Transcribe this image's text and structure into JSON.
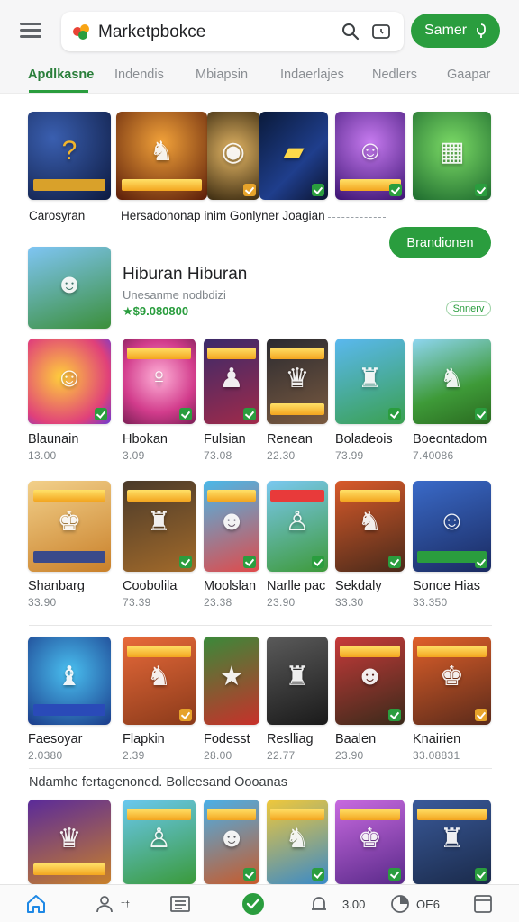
{
  "header": {
    "title": "Marketpbokce",
    "search_icon": "search-icon",
    "wallet_icon": "wallet-icon",
    "signin_label": "Samer"
  },
  "tabs": [
    {
      "label": "Apdlkasne",
      "active": true
    },
    {
      "label": "Indendis",
      "active": false
    },
    {
      "label": "Mbiapsin",
      "active": false
    },
    {
      "label": "Indaerlajes",
      "active": false
    },
    {
      "label": "Nedlers",
      "active": false
    },
    {
      "label": "Gaapar",
      "active": false
    }
  ],
  "carousel": {
    "caption_left": "Carosyran",
    "caption_right": "Hersadononap inim Gonlyner Joagian"
  },
  "featured": {
    "title": "Hiburan Hiburan",
    "subtitle": "Unesanme nodbdizi",
    "price": "★$9.080800",
    "install_label": "Brandionen",
    "pill_label": "Snnerv"
  },
  "grid_rows": [
    [
      {
        "name": "Blaunain",
        "sub": "13.00"
      },
      {
        "name": "Hbokan",
        "sub": "3.09"
      },
      {
        "name": "Fulsian",
        "sub": "73.08"
      },
      {
        "name": "Renean",
        "sub": "22.30"
      },
      {
        "name": "Boladeois",
        "sub": "73.99"
      },
      {
        "name": "Boeontadom",
        "sub": "7.40086"
      }
    ],
    [
      {
        "name": "Shanbarg",
        "sub": "33.90"
      },
      {
        "name": "Coobolila",
        "sub": "73.39"
      },
      {
        "name": "Moolslan",
        "sub": "23.38"
      },
      {
        "name": "Narlle pac",
        "sub": "23.90"
      },
      {
        "name": "Sekdaly",
        "sub": "33.30"
      },
      {
        "name": "Sonoe Hias",
        "sub": "33.350"
      }
    ],
    [
      {
        "name": "Faesoyar",
        "sub": "2.0380"
      },
      {
        "name": "Flapkin",
        "sub": "2.39"
      },
      {
        "name": "Fodesst",
        "sub": "28.00"
      },
      {
        "name": "Reslliag",
        "sub": "22.77"
      },
      {
        "name": "Baalen",
        "sub": "23.90"
      },
      {
        "name": "Knairien",
        "sub": "33.08831"
      }
    ]
  ],
  "section_heading": "Ndamhe fertagenoned. Bolleesand Oooanas",
  "bottom_nav": {
    "home_icon": "home-icon",
    "profile_icon": "profile-icon",
    "profile_label": "††",
    "list_icon": "list-icon",
    "verified_icon": "verified-icon",
    "bell_icon": "bell-icon",
    "bell_value": "3.00",
    "clock_icon": "clock-icon",
    "clock_value": "OE6",
    "window_icon": "window-icon"
  },
  "colors": {
    "accent": "#2a9d3e",
    "tab_active": "#2a7f3b"
  }
}
